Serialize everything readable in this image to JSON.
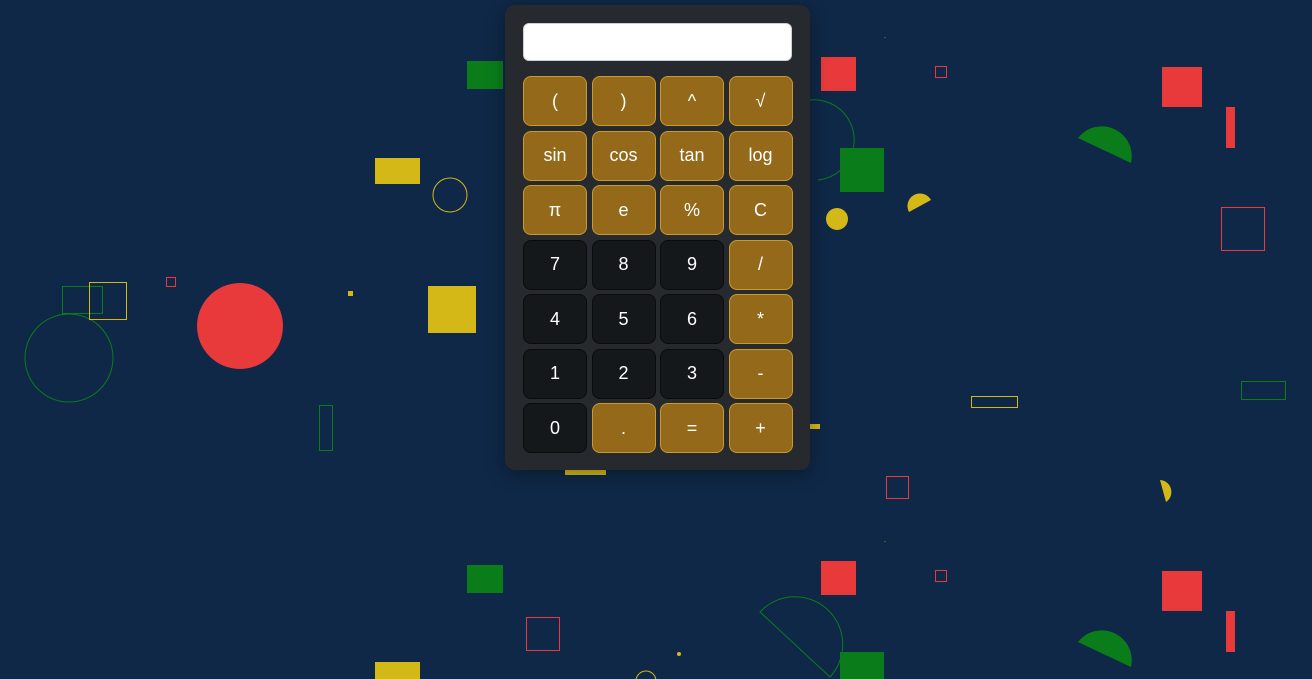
{
  "display": {
    "value": ""
  },
  "colors": {
    "background": "#0f2847",
    "panel": "#262a2e",
    "operator_button": "#946a1a",
    "number_button": "#15181b",
    "shape_red": "#e83a3a",
    "shape_green": "#0a7d1a",
    "shape_yellow": "#d4b818"
  },
  "buttons": [
    {
      "label": "(",
      "kind": "op"
    },
    {
      "label": ")",
      "kind": "op"
    },
    {
      "label": "^",
      "kind": "op"
    },
    {
      "label": "√",
      "kind": "op"
    },
    {
      "label": "sin",
      "kind": "op"
    },
    {
      "label": "cos",
      "kind": "op"
    },
    {
      "label": "tan",
      "kind": "op"
    },
    {
      "label": "log",
      "kind": "op"
    },
    {
      "label": "π",
      "kind": "op"
    },
    {
      "label": "e",
      "kind": "op"
    },
    {
      "label": "%",
      "kind": "op"
    },
    {
      "label": "C",
      "kind": "op"
    },
    {
      "label": "7",
      "kind": "num"
    },
    {
      "label": "8",
      "kind": "num"
    },
    {
      "label": "9",
      "kind": "num"
    },
    {
      "label": "/",
      "kind": "op"
    },
    {
      "label": "4",
      "kind": "num"
    },
    {
      "label": "5",
      "kind": "num"
    },
    {
      "label": "6",
      "kind": "num"
    },
    {
      "label": "*",
      "kind": "op"
    },
    {
      "label": "1",
      "kind": "num"
    },
    {
      "label": "2",
      "kind": "num"
    },
    {
      "label": "3",
      "kind": "num"
    },
    {
      "label": "-",
      "kind": "op"
    },
    {
      "label": "0",
      "kind": "num"
    },
    {
      "label": ".",
      "kind": "op"
    },
    {
      "label": "=",
      "kind": "op"
    },
    {
      "label": "+",
      "kind": "op"
    }
  ]
}
